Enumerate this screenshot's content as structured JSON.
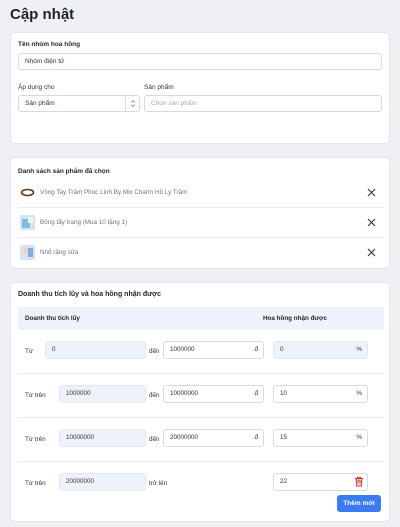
{
  "page": {
    "title": "Cập nhật"
  },
  "group": {
    "name_label": "Tên nhóm hoa hồng",
    "name_value": "Nhóm điện tử",
    "apply_label": "Áp dụng cho",
    "apply_value": "Sản phẩm",
    "product_label": "Sản phẩm",
    "product_placeholder": "Chọn sản phẩm"
  },
  "selected": {
    "heading": "Danh sách sản phẩm đã chọn",
    "items": [
      {
        "name": "Vòng Tay Trầm Phúc Linh By Mix Charm Hồ Ly Trầm"
      },
      {
        "name": "Bông tẩy trang (Mua 10 tặng 1)"
      },
      {
        "name": "Nhổ răng sữa"
      }
    ]
  },
  "commission": {
    "heading": "Doanh thu tích lũy và hoa hồng nhận được",
    "col_revenue": "Doanh thu tích lũy",
    "col_commission": "Hoa hồng nhận được",
    "to_label": "đến",
    "currency": "đ",
    "percent": "%",
    "up_label": "trở lên",
    "rows": [
      {
        "from_label": "Từ",
        "from": "0",
        "to": "1000000",
        "rate": "0"
      },
      {
        "from_label": "Từ trên",
        "from": "1000000",
        "to": "10000000",
        "rate": "10"
      },
      {
        "from_label": "Từ trên",
        "from": "10000000",
        "to": "20000000",
        "rate": "15"
      },
      {
        "from_label": "Từ trên",
        "from": "20000000",
        "rate": "22"
      }
    ],
    "add_button": "Thêm mới"
  },
  "colors": {
    "accent": "#3a7bf0",
    "danger": "#e0322f",
    "header_bg": "#eef3fb"
  }
}
